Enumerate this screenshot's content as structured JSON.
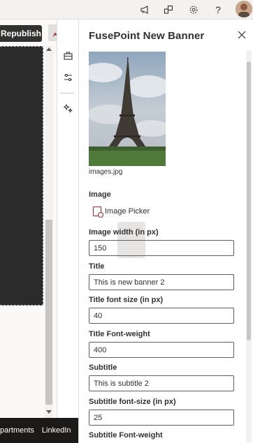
{
  "topbar": {
    "icons": [
      "megaphone-icon",
      "share-icon",
      "settings-icon",
      "help-icon"
    ],
    "help_glyph": "?"
  },
  "canvas": {
    "republish_label": "Republish",
    "footer_links": [
      "partments",
      "LinkedIn"
    ]
  },
  "pane": {
    "title": "FusePoint New Banner",
    "image_filename": "images.jpg",
    "image_label": "Image",
    "image_picker_label": "Image Picker",
    "fields": [
      {
        "label": "Image width (in px)",
        "value": "150"
      },
      {
        "label": "Title",
        "value": "This is new banner 2"
      },
      {
        "label": "Title font size (in px)",
        "value": "40"
      },
      {
        "label": "Title Font-weight",
        "value": "400"
      },
      {
        "label": "Subtitle",
        "value": "This is subtitle 2"
      },
      {
        "label": "Subtitle font-size (in px)",
        "value": "25"
      }
    ],
    "last_label": "Subtitle Font-weight"
  },
  "colors": {
    "dark_button": "#323130",
    "accent_red": "#a4262c",
    "footer_bg": "#1b1a19"
  }
}
